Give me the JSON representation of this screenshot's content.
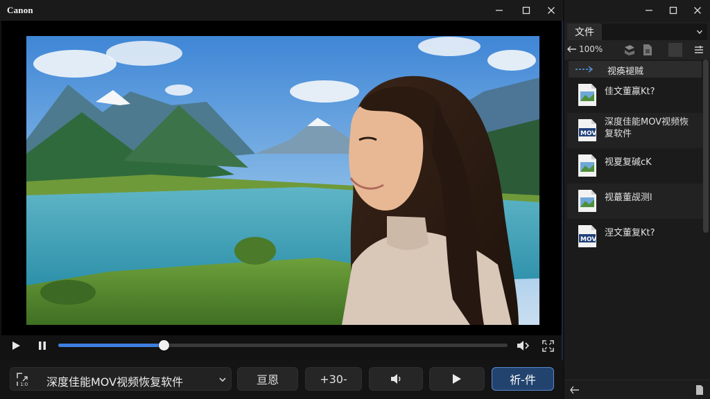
{
  "player": {
    "app_logo": "Canon",
    "progress": 0.235,
    "file_select": {
      "value": "深度佳能MOV视频恢复软件"
    },
    "buttons": {
      "b1": "亘恩",
      "b2": "+30-",
      "primary": "祈-件"
    }
  },
  "panel": {
    "tab_label": "文件",
    "zoom_label": "100%",
    "nav_label": "视痪褪贼",
    "files": [
      {
        "name": "佳文董羸Kt?",
        "icon": "image-file-icon"
      },
      {
        "name": "深度佳能MOV视频恢复软件",
        "icon": "mov-file-icon"
      },
      {
        "name": "视夏复碱cK",
        "icon": "image-file-icon"
      },
      {
        "name": "视蕞董觇测l",
        "icon": "image-file-icon"
      },
      {
        "name": "涅文董复Kt?",
        "icon": "mov-file-icon"
      }
    ],
    "mov_badge": "MOV"
  },
  "colors": {
    "accent": "#3d7fe0",
    "primary_button": "#23436f",
    "background": "#121212"
  }
}
